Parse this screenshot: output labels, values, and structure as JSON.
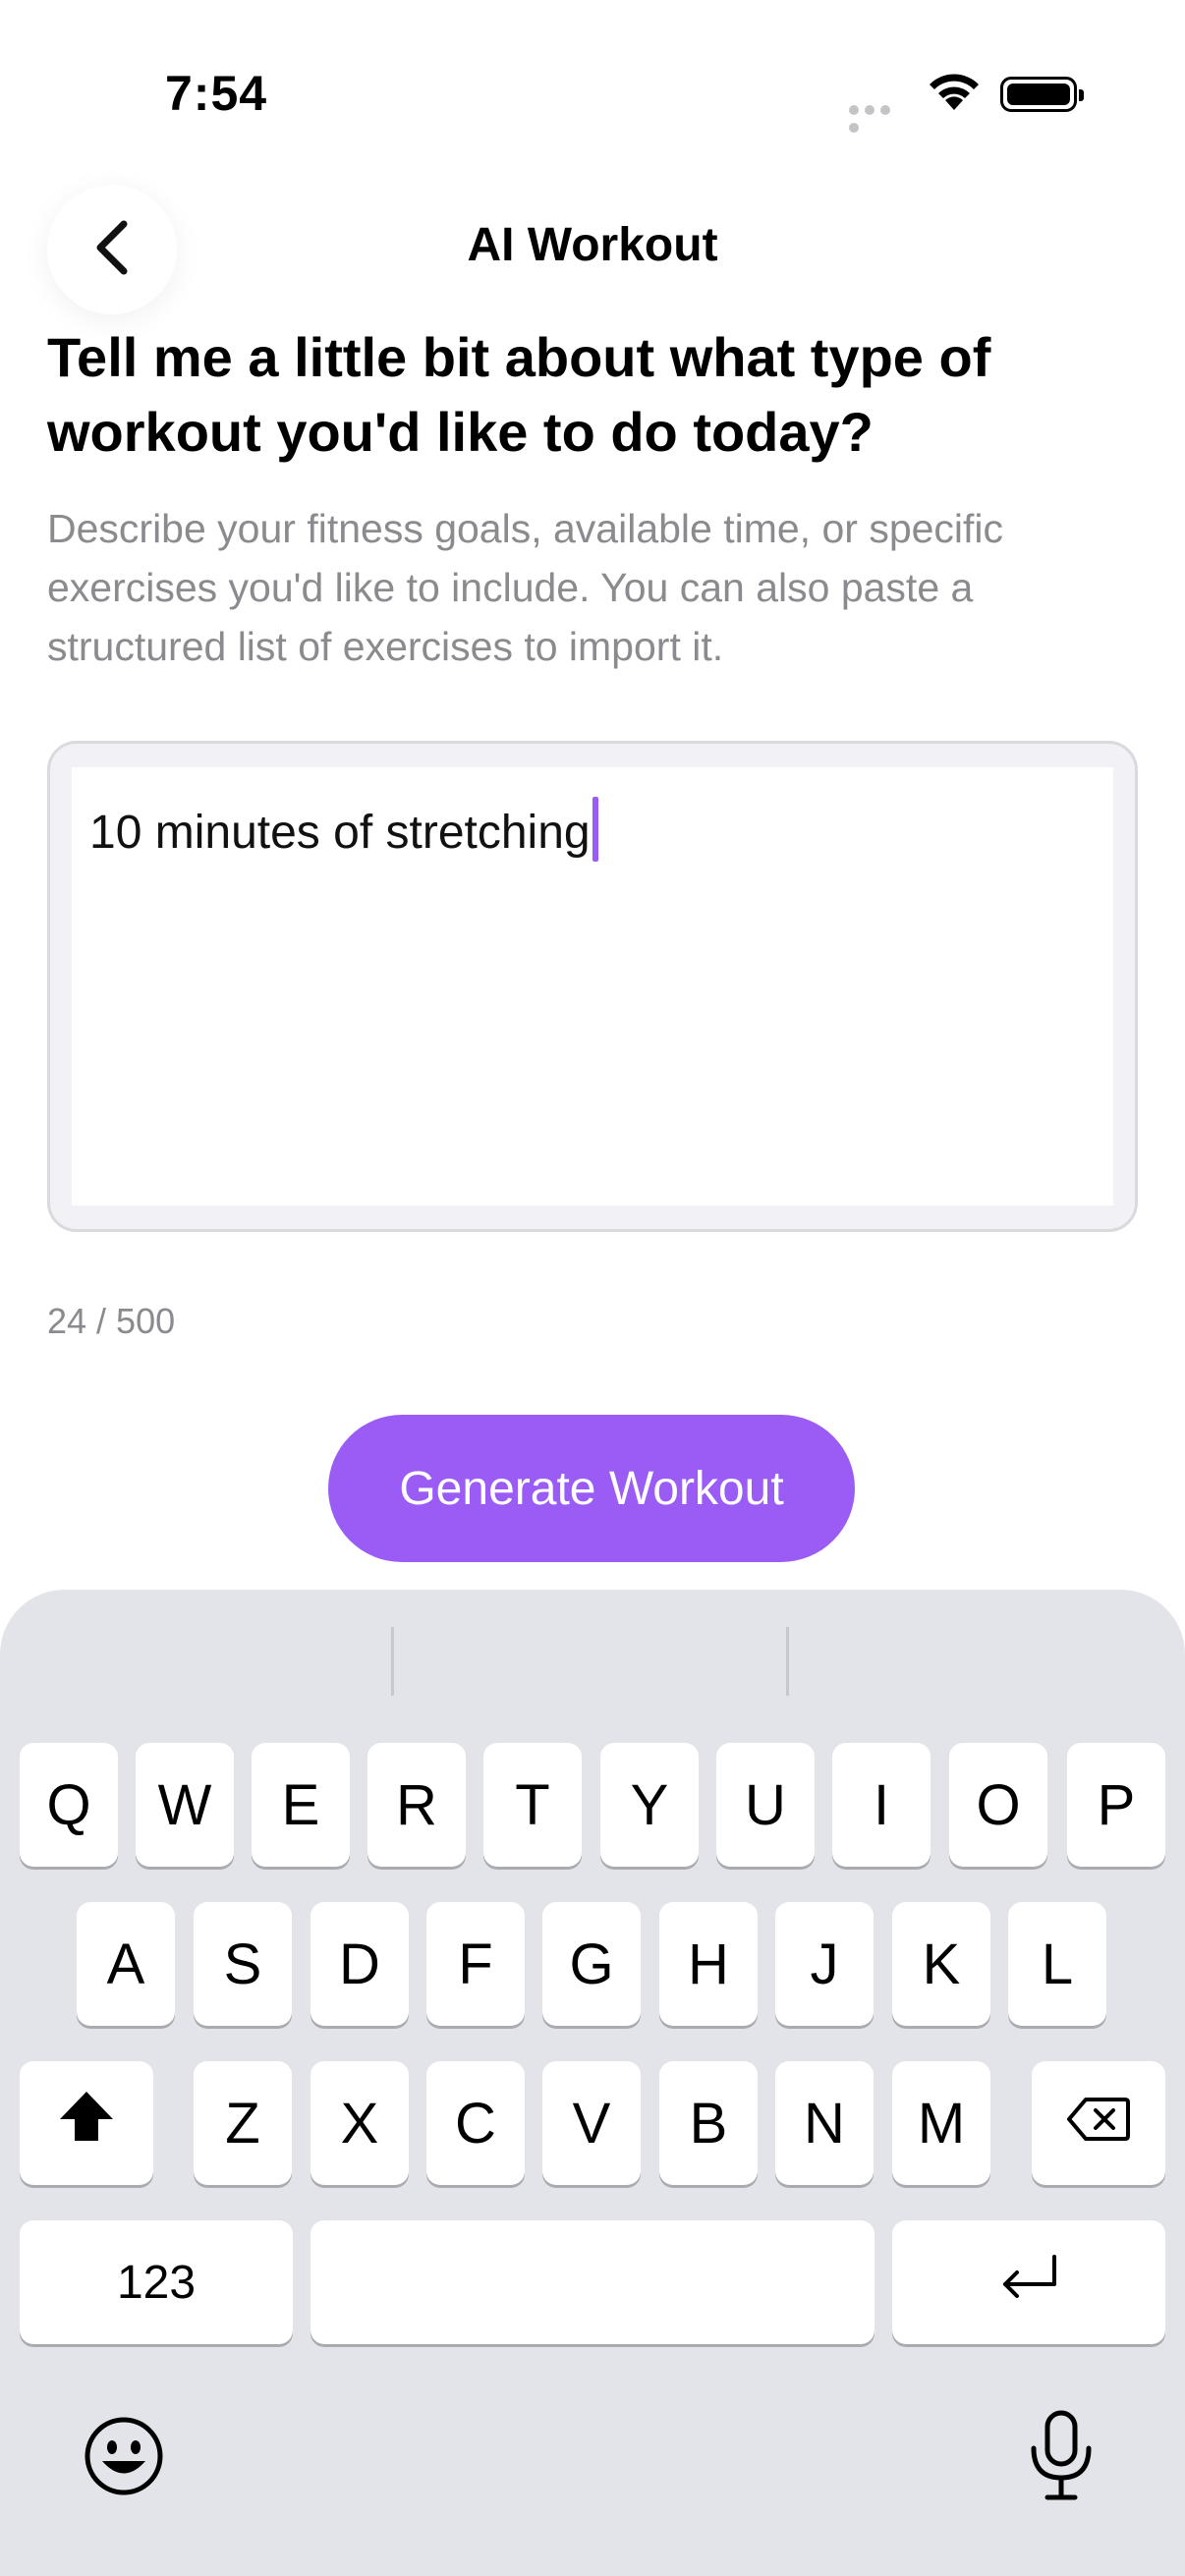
{
  "status_bar": {
    "time": "7:54"
  },
  "header": {
    "title": "AI Workout"
  },
  "prompt": {
    "heading": "Tell me a little bit about what type of workout you'd like to do today?",
    "description": "Describe your fitness goals, available time, or specific exercises you'd like to include. You can also paste a structured list of exercises to import it."
  },
  "input": {
    "value": "10 minutes of stretching"
  },
  "char_count": "24 / 500",
  "generate_button": {
    "label": "Generate Workout"
  },
  "keyboard": {
    "row1": [
      "Q",
      "W",
      "E",
      "R",
      "T",
      "Y",
      "U",
      "I",
      "O",
      "P"
    ],
    "row2": [
      "A",
      "S",
      "D",
      "F",
      "G",
      "H",
      "J",
      "K",
      "L"
    ],
    "row3": [
      "Z",
      "X",
      "C",
      "V",
      "B",
      "N",
      "M"
    ],
    "numbers_label": "123"
  },
  "colors": {
    "accent": "#9b5cf6",
    "keyboard_bg": "#e3e4e9",
    "secondary_text": "#8a8a8f"
  },
  "icons": [
    "chevron-left-icon",
    "wifi-icon",
    "battery-icon",
    "shift-icon",
    "delete-icon",
    "return-icon",
    "emoji-icon",
    "microphone-icon"
  ]
}
